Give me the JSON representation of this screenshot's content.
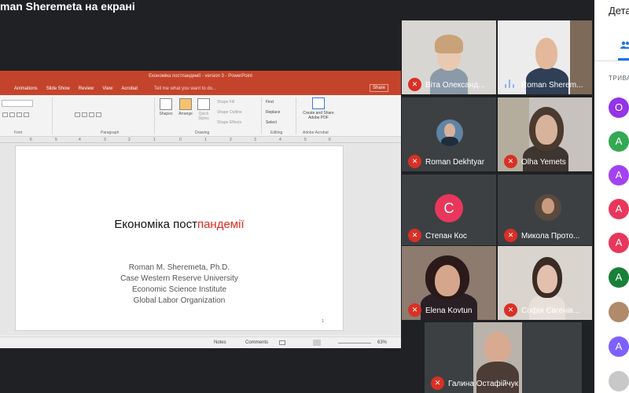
{
  "presentation_title": "man Sheremeta на екрані",
  "ppt": {
    "window_title": "Економіка постпандемії - version 3 - PowerPoint",
    "tabs": [
      "Animations",
      "Slide Show",
      "Review",
      "View",
      "Acrobat"
    ],
    "tell_me": "Tell me what you want to do...",
    "share": "Share",
    "groups": {
      "font": "Font",
      "paragraph": "Paragraph",
      "drawing": "Drawing",
      "editing": "Editing",
      "acrobat": "Adobe Acrobat"
    },
    "buttons": {
      "shapes": "Shapes",
      "arrange": "Arrange",
      "quick_styles": "Quick Styles",
      "shape_fill": "Shape Fill",
      "shape_outline": "Shape Outline",
      "shape_effects": "Shape Effects",
      "find": "Find",
      "replace": "Replace",
      "select": "Select",
      "create_pdf": "Create and Share Adobe PDF"
    },
    "slide": {
      "title_black": "Економіка пост",
      "title_red": "пандемії",
      "lines": [
        "Roman M. Sheremeta, Ph.D.",
        "Case Western Reserve University",
        "Economic Science Institute",
        "Global Labor Organization"
      ],
      "page_number": "1"
    },
    "status": {
      "notes": "Notes",
      "comments": "Comments",
      "zoom": "63%"
    }
  },
  "participants": [
    {
      "name": "Віта Олександ...",
      "muted": true
    },
    {
      "name": "Roman Sherem...",
      "muted": false
    },
    {
      "name": "Roman Dekhtyar",
      "muted": true
    },
    {
      "name": "Olha Yemets",
      "muted": true
    },
    {
      "name": "Степан Кос",
      "muted": true,
      "initial": "C"
    },
    {
      "name": "Микола Прото...",
      "muted": true
    },
    {
      "name": "Elena Kovtun",
      "muted": true
    },
    {
      "name": "Софія Євгенів...",
      "muted": true
    },
    {
      "name": "Галина Остафійчук",
      "muted": true
    }
  ],
  "panel": {
    "title": "Дета",
    "section": "ТРИВА",
    "avatars": [
      {
        "letter": "O",
        "color": "#9334e6"
      },
      {
        "letter": "A",
        "color": "#34a853"
      },
      {
        "letter": "A",
        "color": "#a142f4"
      },
      {
        "letter": "A",
        "color": "#e8375b"
      },
      {
        "letter": "A",
        "color": "#e8375b"
      },
      {
        "letter": "A",
        "color": "#188038"
      },
      {
        "letter": "",
        "color": "#b08a6a"
      },
      {
        "letter": "A",
        "color": "#7b61ff"
      },
      {
        "letter": "",
        "color": "#c8c8c8"
      }
    ]
  },
  "colors": {
    "ppt_accent": "#c4432b",
    "muted_red": "#d93025",
    "meet_blue": "#1a73e8"
  }
}
